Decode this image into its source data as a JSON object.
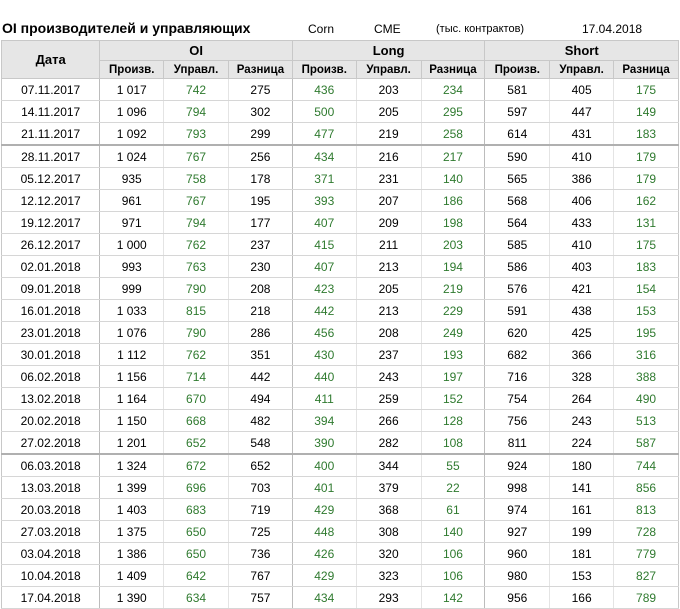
{
  "header": {
    "title": "OI производителей и управляющих",
    "commodity": "Corn",
    "exchange": "CME",
    "units": "(тыс. контрактов)",
    "report_date": "17.04.2018"
  },
  "table": {
    "date_header": "Дата",
    "groups": [
      "OI",
      "Long",
      "Short"
    ],
    "subheaders": [
      "Произв.",
      "Управл.",
      "Разница"
    ],
    "accent_color": "#2f7a2f",
    "rows": [
      [
        "07.11.2017",
        "1 017",
        "742",
        "275",
        "436",
        "203",
        "234",
        "581",
        "405",
        "175"
      ],
      [
        "14.11.2017",
        "1 096",
        "794",
        "302",
        "500",
        "205",
        "295",
        "597",
        "447",
        "149"
      ],
      [
        "21.11.2017",
        "1 092",
        "793",
        "299",
        "477",
        "219",
        "258",
        "614",
        "431",
        "183"
      ],
      [
        "28.11.2017",
        "1 024",
        "767",
        "256",
        "434",
        "216",
        "217",
        "590",
        "410",
        "179"
      ],
      [
        "05.12.2017",
        "935",
        "758",
        "178",
        "371",
        "231",
        "140",
        "565",
        "386",
        "179"
      ],
      [
        "12.12.2017",
        "961",
        "767",
        "195",
        "393",
        "207",
        "186",
        "568",
        "406",
        "162"
      ],
      [
        "19.12.2017",
        "971",
        "794",
        "177",
        "407",
        "209",
        "198",
        "564",
        "433",
        "131"
      ],
      [
        "26.12.2017",
        "1 000",
        "762",
        "237",
        "415",
        "211",
        "203",
        "585",
        "410",
        "175"
      ],
      [
        "02.01.2018",
        "993",
        "763",
        "230",
        "407",
        "213",
        "194",
        "586",
        "403",
        "183"
      ],
      [
        "09.01.2018",
        "999",
        "790",
        "208",
        "423",
        "205",
        "219",
        "576",
        "421",
        "154"
      ],
      [
        "16.01.2018",
        "1 033",
        "815",
        "218",
        "442",
        "213",
        "229",
        "591",
        "438",
        "153"
      ],
      [
        "23.01.2018",
        "1 076",
        "790",
        "286",
        "456",
        "208",
        "249",
        "620",
        "425",
        "195"
      ],
      [
        "30.01.2018",
        "1 112",
        "762",
        "351",
        "430",
        "237",
        "193",
        "682",
        "366",
        "316"
      ],
      [
        "06.02.2018",
        "1 156",
        "714",
        "442",
        "440",
        "243",
        "197",
        "716",
        "328",
        "388"
      ],
      [
        "13.02.2018",
        "1 164",
        "670",
        "494",
        "411",
        "259",
        "152",
        "754",
        "264",
        "490"
      ],
      [
        "20.02.2018",
        "1 150",
        "668",
        "482",
        "394",
        "266",
        "128",
        "756",
        "243",
        "513"
      ],
      [
        "27.02.2018",
        "1 201",
        "652",
        "548",
        "390",
        "282",
        "108",
        "811",
        "224",
        "587"
      ],
      [
        "06.03.2018",
        "1 324",
        "672",
        "652",
        "400",
        "344",
        "55",
        "924",
        "180",
        "744"
      ],
      [
        "13.03.2018",
        "1 399",
        "696",
        "703",
        "401",
        "379",
        "22",
        "998",
        "141",
        "856"
      ],
      [
        "20.03.2018",
        "1 403",
        "683",
        "719",
        "429",
        "368",
        "61",
        "974",
        "161",
        "813"
      ],
      [
        "27.03.2018",
        "1 375",
        "650",
        "725",
        "448",
        "308",
        "140",
        "927",
        "199",
        "728"
      ],
      [
        "03.04.2018",
        "1 386",
        "650",
        "736",
        "426",
        "320",
        "106",
        "960",
        "181",
        "779"
      ],
      [
        "10.04.2018",
        "1 409",
        "642",
        "767",
        "429",
        "323",
        "106",
        "980",
        "153",
        "827"
      ],
      [
        "17.04.2018",
        "1 390",
        "634",
        "757",
        "434",
        "293",
        "142",
        "956",
        "166",
        "789"
      ]
    ]
  }
}
